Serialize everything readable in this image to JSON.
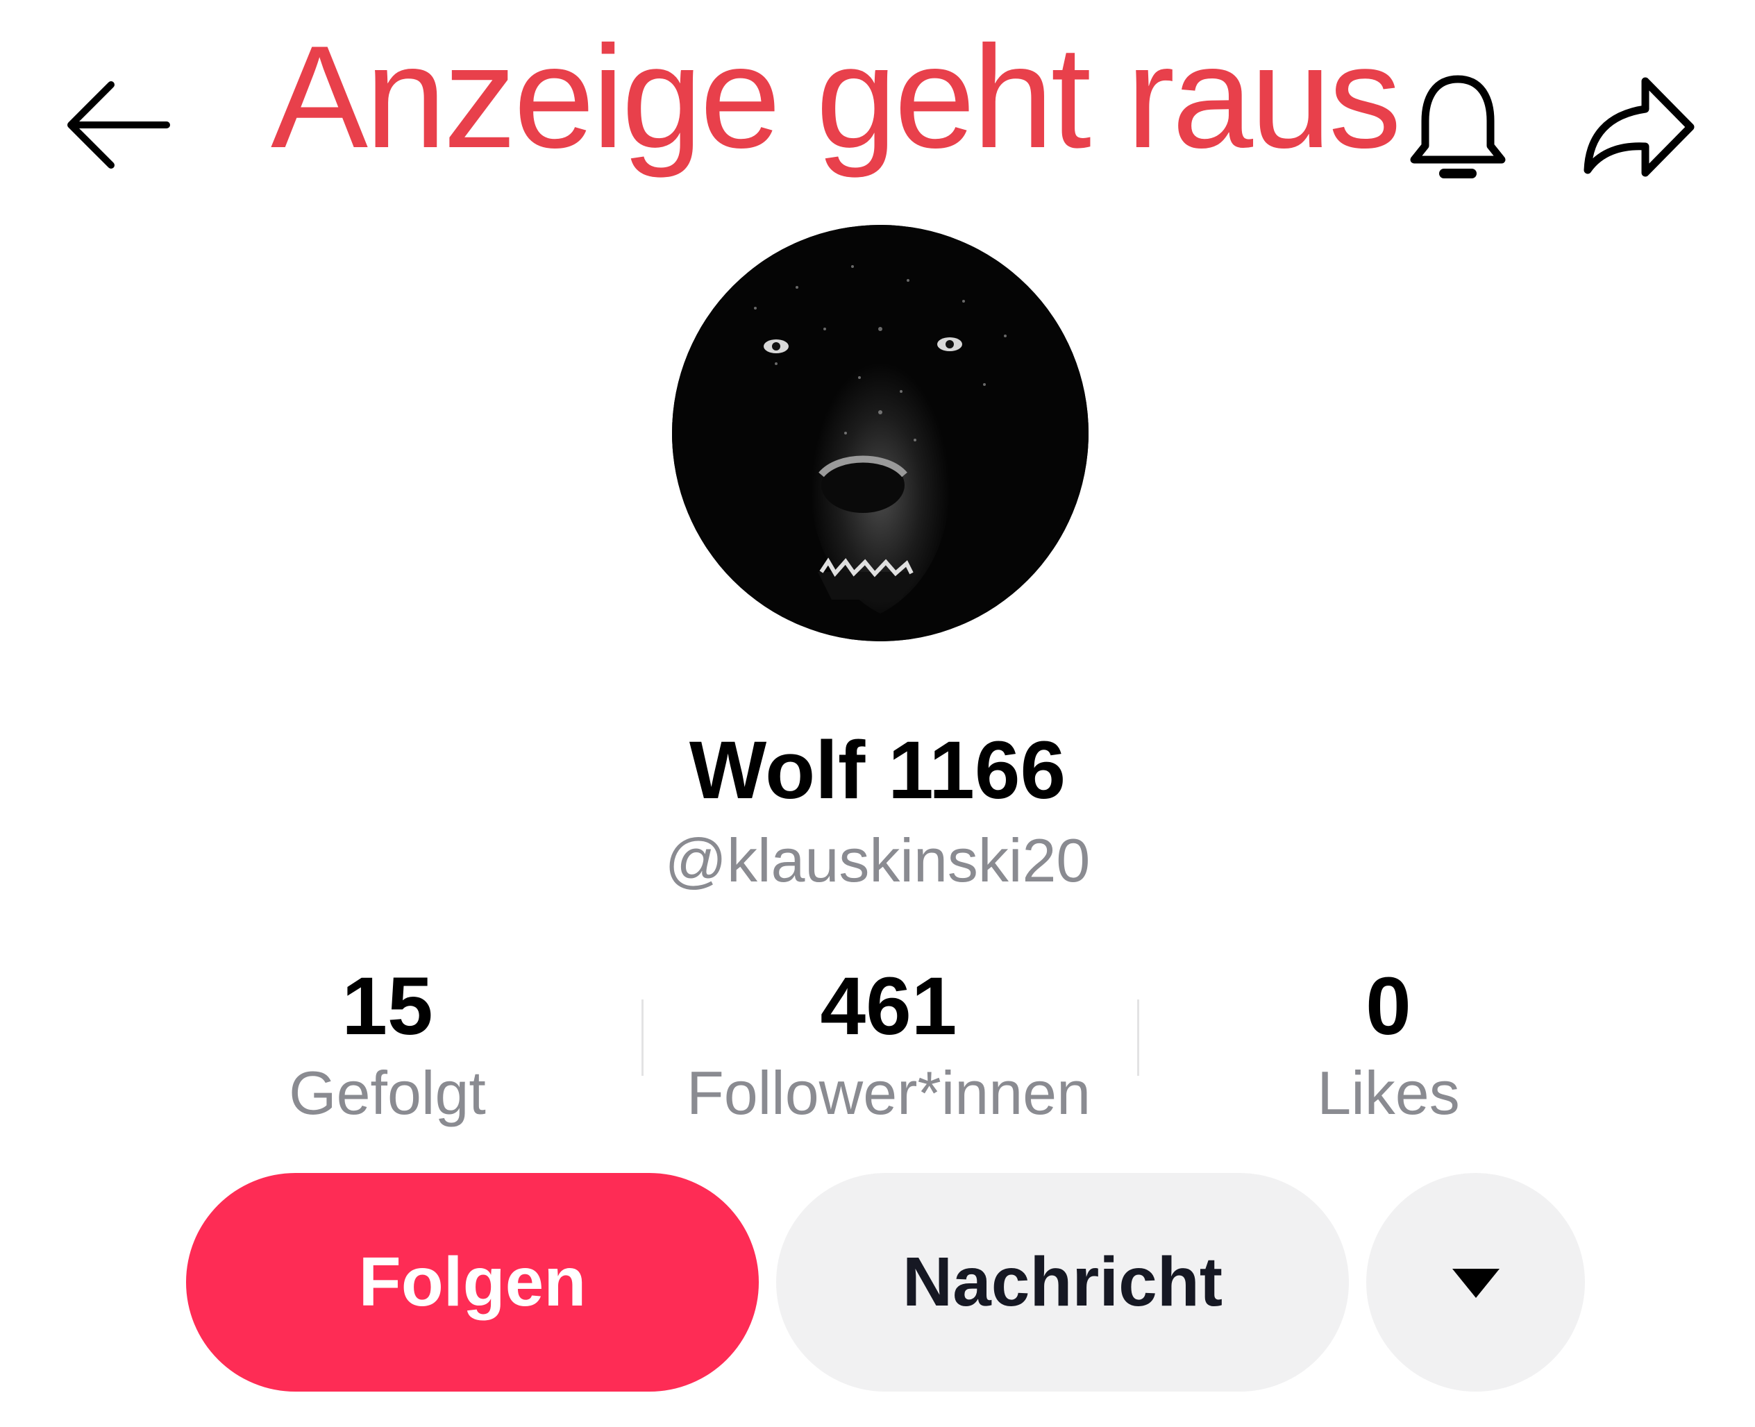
{
  "overlay": {
    "caption": "Anzeige geht raus",
    "caption_color": "#e8404b"
  },
  "header": {
    "back_icon": "arrow-left-icon",
    "bell_icon": "bell-icon",
    "share_icon": "share-arrow-icon"
  },
  "profile": {
    "avatar_icon": "wolf-avatar",
    "name": "Wolf 1166",
    "handle": "@klauskinski20"
  },
  "stats": [
    {
      "value": "15",
      "label": "Gefolgt"
    },
    {
      "value": "461",
      "label": "Follower*innen"
    },
    {
      "value": "0",
      "label": "Likes"
    }
  ],
  "actions": {
    "follow_label": "Folgen",
    "message_label": "Nachricht",
    "more_icon": "caret-down-icon",
    "follow_color": "#fe2c55",
    "secondary_color": "#f1f1f2"
  }
}
